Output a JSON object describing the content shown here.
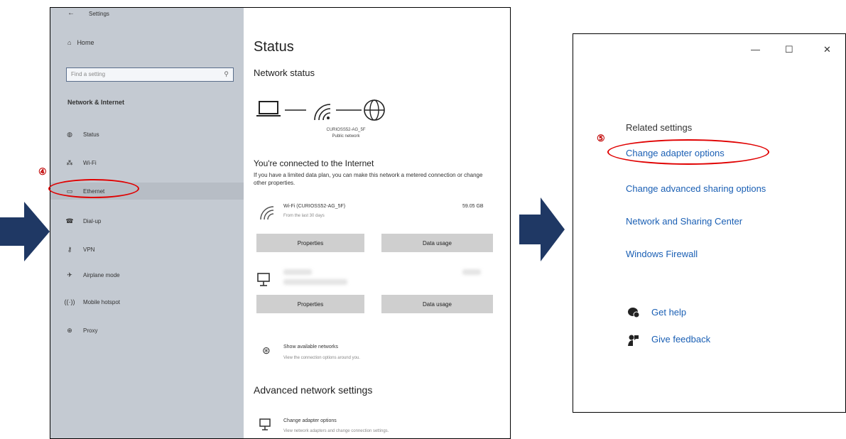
{
  "settings": {
    "window_title": "Settings",
    "home": "Home",
    "search_placeholder": "Find a setting",
    "section_header": "Network & Internet",
    "nav": [
      {
        "label": "Status",
        "icon": "home-status-icon",
        "active": false
      },
      {
        "label": "Wi-Fi",
        "icon": "wifi-icon",
        "active": false
      },
      {
        "label": "Ethernet",
        "icon": "ethernet-icon",
        "active": true
      },
      {
        "label": "Dial-up",
        "icon": "phone-icon",
        "active": false
      },
      {
        "label": "VPN",
        "icon": "vpn-icon",
        "active": false
      },
      {
        "label": "Airplane mode",
        "icon": "airplane-icon",
        "active": false
      },
      {
        "label": "Mobile hotspot",
        "icon": "hotspot-icon",
        "active": false
      },
      {
        "label": "Proxy",
        "icon": "globe-icon",
        "active": false
      }
    ],
    "main": {
      "title": "Status",
      "network_status": "Network status",
      "network_name": "CURIOSS52-AG_5F",
      "network_type": "Public network",
      "connected_heading": "You're connected to the Internet",
      "limited_text": "If you have a limited data plan, you can make this network a metered connection or change other properties.",
      "wifi_label": "Wi-Fi (CURIOSS52-AG_5F)",
      "wifi_sub": "From the last 30 days",
      "wifi_usage": "59.05 GB",
      "properties_label": "Properties",
      "data_usage_label": "Data usage",
      "show_networks": "Show available networks",
      "show_networks_sub": "View the connection options around you.",
      "advanced_heading": "Advanced network settings",
      "change_adapter": "Change adapter options",
      "change_adapter_sub": "View network adapters and change connection settings."
    }
  },
  "related": {
    "title": "Related settings",
    "links": [
      "Change adapter options",
      "Change advanced sharing options",
      "Network and Sharing Center",
      "Windows Firewall"
    ],
    "help": "Get help",
    "feedback": "Give feedback"
  },
  "annotations": {
    "step4": "④",
    "step5": "⑤",
    "highlight_color": "#e00000",
    "arrow_color": "#1f3864"
  }
}
